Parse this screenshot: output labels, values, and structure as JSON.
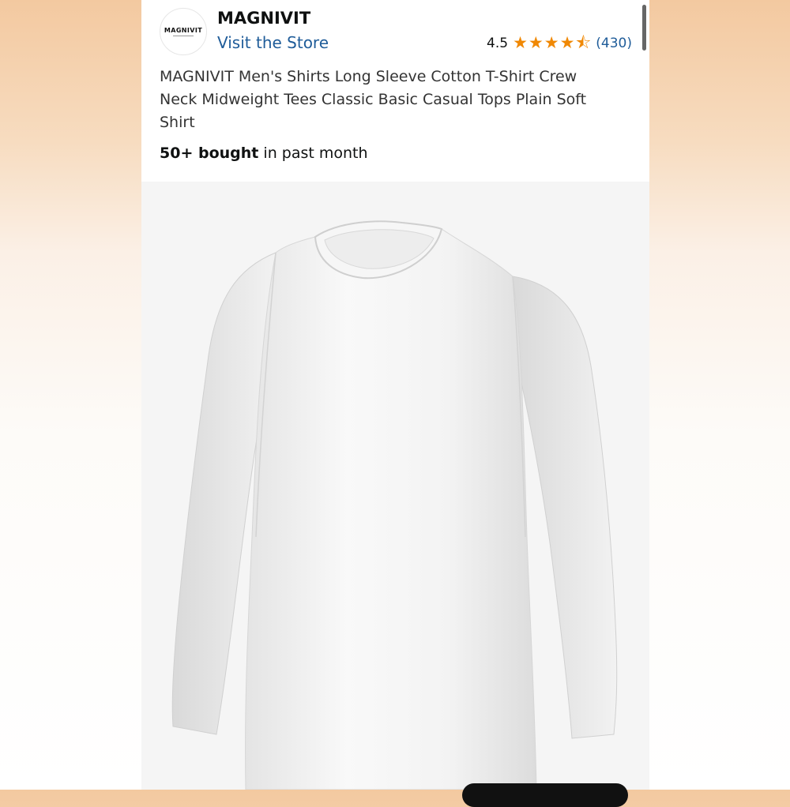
{
  "brand": {
    "logo_text": "MAGNIVIT",
    "name": "MAGNIVIT",
    "visit_store": "Visit the Store"
  },
  "rating": {
    "value": "4.5",
    "stars": 4.5,
    "count": "(430)"
  },
  "product": {
    "title": "MAGNIVIT Men's Shirts Long Sleeve Cotton T-Shirt Crew Neck Midweight Tees Classic Basic Casual Tops Plain Soft Shirt",
    "bought_bold": "50+ bought",
    "bought_rest": " in past month"
  },
  "colors": {
    "star": "#f08804",
    "link": "#1f5c99"
  }
}
